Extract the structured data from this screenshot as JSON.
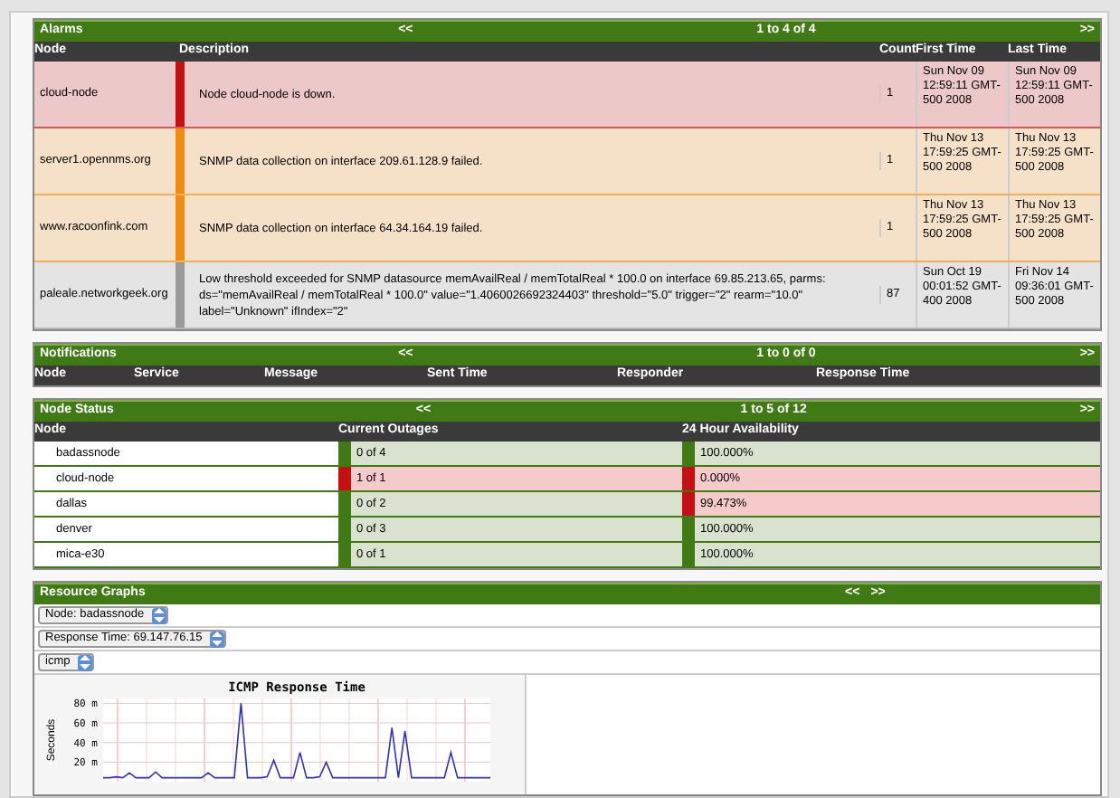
{
  "alarms": {
    "title": "Alarms",
    "prev": "<<",
    "range": "1 to 4 of 4",
    "next": ">>",
    "columns": [
      "Node",
      "Description",
      "Count",
      "First Time",
      "Last Time"
    ],
    "rows": [
      {
        "node": "cloud-node",
        "color": "#c41010",
        "description": "Node cloud-node is down.",
        "count": "1",
        "first_time": "Sun Nov 09 12:59:11 GMT-500 2008",
        "last_time": "Sun Nov 09 12:59:11 GMT-500 2008"
      },
      {
        "node": "server1.opennms.org",
        "color": "#f08c10",
        "description": "SNMP data collection on interface 209.61.128.9 failed.",
        "count": "1",
        "first_time": "Thu Nov 13 17:59:25 GMT-500 2008",
        "last_time": "Thu Nov 13 17:59:25 GMT-500 2008"
      },
      {
        "node": "www.racoonfink.com",
        "color": "#f08c10",
        "description": "SNMP data collection on interface 64.34.164.19 failed.",
        "count": "1",
        "first_time": "Thu Nov 13 17:59:25 GMT-500 2008",
        "last_time": "Thu Nov 13 17:59:25 GMT-500 2008"
      },
      {
        "node": "paleale.networkgeek.org",
        "color": "#999999",
        "description": "Low threshold exceeded for SNMP datasource memAvailReal / memTotalReal * 100.0 on interface 69.85.213.65, parms: ds=\"memAvailReal / memTotalReal * 100.0\" value=\"1.4060026692324403\" threshold=\"5.0\" trigger=\"2\" rearm=\"10.0\" label=\"Unknown\" ifIndex=\"2\"",
        "count": "87",
        "first_time": "Sun Oct 19 00:01:52 GMT-400 2008",
        "last_time": "Fri Nov 14 09:36:01 GMT-500 2008"
      }
    ]
  },
  "notifications": {
    "title": "Notifications",
    "prev": "<<",
    "range": "1 to 0 of 0",
    "next": ">>",
    "columns": [
      "Node",
      "Service",
      "Message",
      "Sent Time",
      "Responder",
      "Response Time"
    ]
  },
  "node_status": {
    "title": "Node Status",
    "prev": "<<",
    "range": "1 to 5 of 12",
    "next": ">>",
    "columns": [
      "Node",
      "Current Outages",
      "24 Hour Availability"
    ],
    "rows": [
      {
        "node": "badassnode",
        "outages": "0 of 4",
        "outage_alert": false,
        "availability": "100.000%",
        "availability_alert": false
      },
      {
        "node": "cloud-node",
        "outages": "1 of 1",
        "outage_alert": true,
        "availability": "0.000%",
        "availability_alert": true
      },
      {
        "node": "dallas",
        "outages": "0 of 2",
        "outage_alert": false,
        "availability": "99.473%",
        "availability_alert": true
      },
      {
        "node": "denver",
        "outages": "0 of 3",
        "outage_alert": false,
        "availability": "100.000%",
        "availability_alert": false
      },
      {
        "node": "mica-e30",
        "outages": "0 of 1",
        "outage_alert": false,
        "availability": "100.000%",
        "availability_alert": false
      }
    ]
  },
  "resource_graphs": {
    "title": "Resource Graphs",
    "prev": "<<",
    "next": ">>",
    "selects": [
      "Node: badassnode",
      "Response Time: 69.147.76.15",
      "icmp"
    ],
    "graph": {
      "chart_data": {
        "type": "line",
        "title": "ICMP Response Time",
        "ylabel": "Seconds",
        "ylim": [
          0,
          85
        ],
        "yticks": [
          {
            "value": 20,
            "label": "20 m"
          },
          {
            "value": 40,
            "label": "40 m"
          },
          {
            "value": 60,
            "label": "60 m"
          },
          {
            "value": 80,
            "label": "80 m"
          }
        ],
        "grid": true,
        "series": [
          {
            "color": "#3030c0",
            "values": [
              4,
              4,
              5,
              4,
              9,
              4,
              4,
              4,
              10,
              4,
              4,
              4,
              4,
              4,
              4,
              4,
              9,
              4,
              4,
              4,
              4,
              80,
              4,
              4,
              4,
              5,
              22,
              4,
              4,
              4,
              30,
              4,
              4,
              5,
              20,
              4,
              4,
              4,
              4,
              4,
              4,
              4,
              4,
              4,
              55,
              4,
              52,
              4,
              4,
              4,
              4,
              4,
              4,
              30,
              4,
              4,
              4,
              4,
              4,
              4
            ]
          }
        ]
      }
    }
  }
}
